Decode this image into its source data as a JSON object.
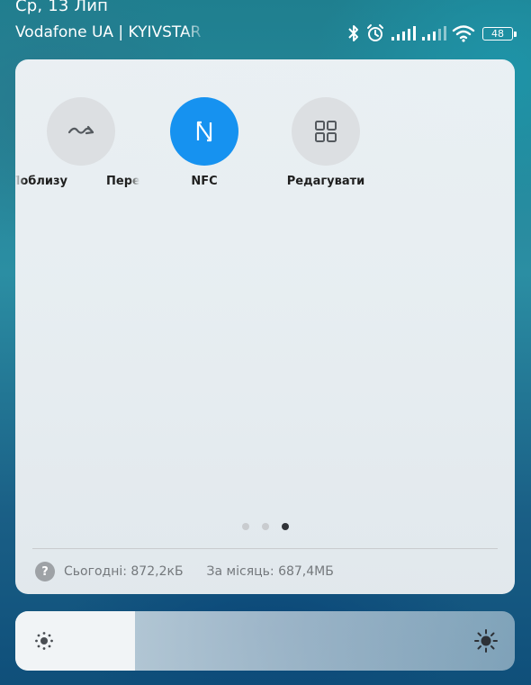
{
  "status_bar": {
    "date": "Ср, 13 Лип",
    "carrier": "Vodafone UA | KYIVSTAR",
    "battery_level": "48"
  },
  "quick_settings": {
    "tiles": [
      {
        "label": "Поблизу",
        "icon": "nearby-share-icon",
        "active": false
      },
      {
        "label": "Переміщення",
        "icon": "transfer-icon",
        "active": false
      },
      {
        "label": "NFC",
        "icon": "nfc-icon",
        "active": true
      },
      {
        "label": "Редагувати",
        "icon": "grid-edit-icon",
        "active": false
      }
    ],
    "page_indicator": {
      "pages": 3,
      "current": 3
    },
    "data_usage": {
      "today": "Сьогодні: 872,2кБ",
      "month": "За місяць: 687,4МБ"
    }
  },
  "brightness": {
    "level_fraction": 0.24,
    "low_icon": "brightness-low-icon",
    "high_icon": "brightness-high-icon"
  },
  "colors": {
    "accent": "#1692F0",
    "tile_inactive": "#DCDFE2",
    "text_primary": "#1F1F1F",
    "text_secondary": "#74787C"
  }
}
